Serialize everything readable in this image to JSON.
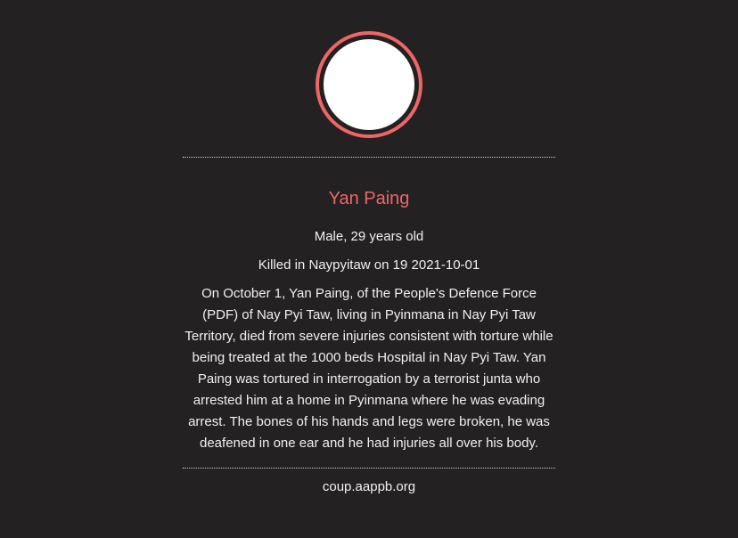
{
  "profile": {
    "name": "Yan Paing",
    "gender_age": "Male, 29 years old",
    "killed": "Killed in Naypyitaw on 19 2021-10-01",
    "story": "On October 1, Yan Paing, of the People's Defence Force (PDF) of Nay Pyi Taw, living in Pyinmana in Nay Pyi Taw Territory, died from severe injuries consistent with torture while being treated at the 1000 beds Hospital in Nay Pyi Taw. Yan Paing was tortured in interrogation by a terrorist junta who arrested him at a home in Pyinmana where he was evading arrest. The bones of his hands and legs were broken, he was deafened in one ear and he had injuries all over his body.",
    "source": "coup.aappb.org"
  },
  "colors": {
    "background": "#242122",
    "accent": "#ee6666",
    "text": "#f0f0f0"
  }
}
